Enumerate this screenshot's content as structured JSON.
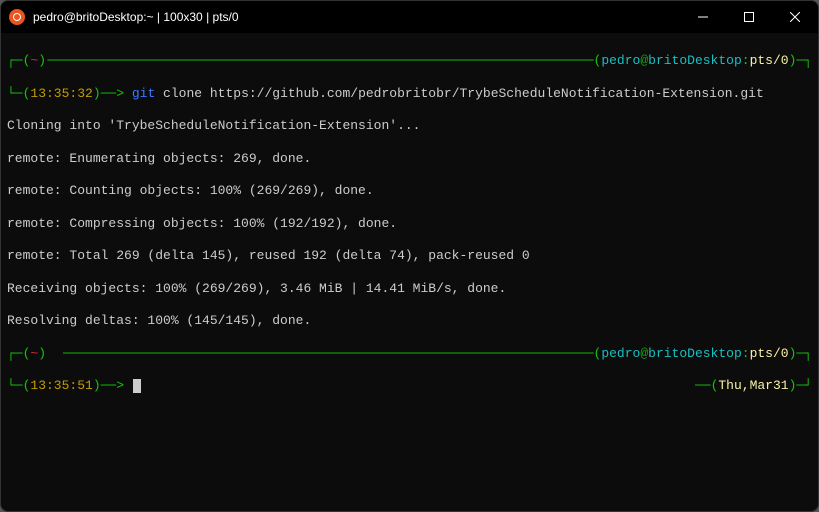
{
  "window": {
    "title": "pedro@britoDesktop:~ | 100x30 | pts/0"
  },
  "prompt1": {
    "tilde": "~",
    "time": "13:35:32",
    "arrow": "─",
    "user": "pedro",
    "at": "@",
    "host": "britoDesktop",
    "sep": ":",
    "tty": "pts/0",
    "cmd_git": "git",
    "cmd_rest": " clone https://github.com/pedrobritobr/TrybeScheduleNotification-Extension.git"
  },
  "output": {
    "l1": "Cloning into 'TrybeScheduleNotification-Extension'...",
    "l2": "remote: Enumerating objects: 269, done.",
    "l3": "remote: Counting objects: 100% (269/269), done.",
    "l4": "remote: Compressing objects: 100% (192/192), done.",
    "l5": "remote: Total 269 (delta 145), reused 192 (delta 74), pack-reused 0",
    "l6": "Receiving objects: 100% (269/269), 3.46 MiB | 14.41 MiB/s, done.",
    "l7": "Resolving deltas: 100% (145/145), done."
  },
  "prompt2": {
    "tilde": "~",
    "time": "13:35:51",
    "user": "pedro",
    "at": "@",
    "host": "britoDesktop",
    "sep": ":",
    "tty": "pts/0",
    "date": "Thu,Mar31"
  },
  "deco": {
    "lbracket_top": "┌─(",
    "rbracket_top_close": ")",
    "dashfill1": "──────────────────────────────────────────────────────────────────────(",
    "rparen_close_nl": ")─┐",
    "lbracket_bot": "└─(",
    "arrow_end": ")──> ",
    "dashfill2": "────────────────────────────────────────────────────────────────────(",
    "date_open": "──(",
    "date_close": ")─┘"
  }
}
